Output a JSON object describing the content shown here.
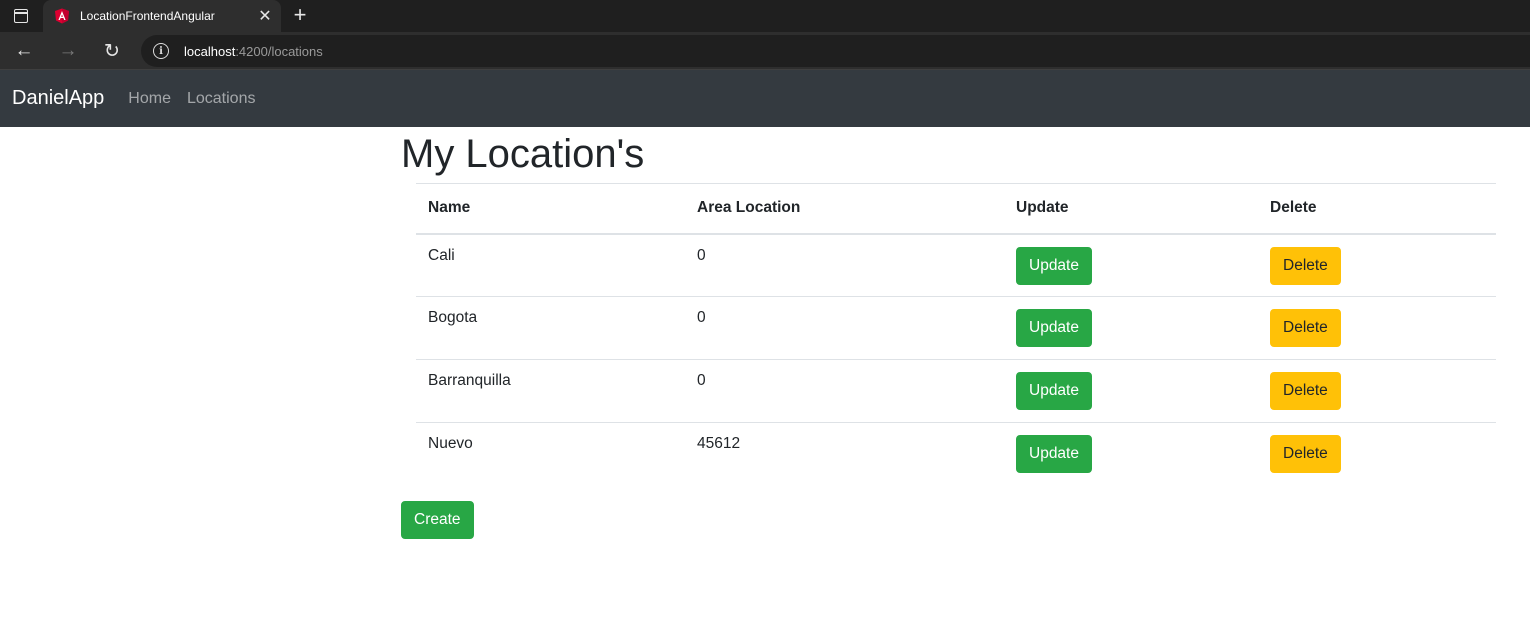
{
  "browser": {
    "tab_title": "LocationFrontendAngular",
    "tab_close_glyph": "✕",
    "new_tab_glyph": "+",
    "url_host": "localhost",
    "url_rest": ":4200/locations",
    "back_glyph": "←",
    "forward_glyph": "→",
    "reload_glyph": "↻",
    "info_glyph": "i"
  },
  "navbar": {
    "brand": "DanielApp",
    "links": [
      "Home",
      "Locations"
    ]
  },
  "page": {
    "title": "My Location's",
    "create_label": "Create"
  },
  "table": {
    "headers": [
      "Name",
      "Area Location",
      "Update",
      "Delete"
    ],
    "rows": [
      {
        "name": "Cali",
        "area": "0",
        "update_label": "Update",
        "delete_label": "Delete"
      },
      {
        "name": "Bogota",
        "area": "0",
        "update_label": "Update",
        "delete_label": "Delete"
      },
      {
        "name": "Barranquilla",
        "area": "0",
        "update_label": "Update",
        "delete_label": "Delete"
      },
      {
        "name": "Nuevo",
        "area": "45612",
        "update_label": "Update",
        "delete_label": "Delete"
      }
    ]
  },
  "colors": {
    "navbar_bg": "#343a40",
    "success": "#28a745",
    "warning": "#ffc107",
    "text": "#212529"
  }
}
